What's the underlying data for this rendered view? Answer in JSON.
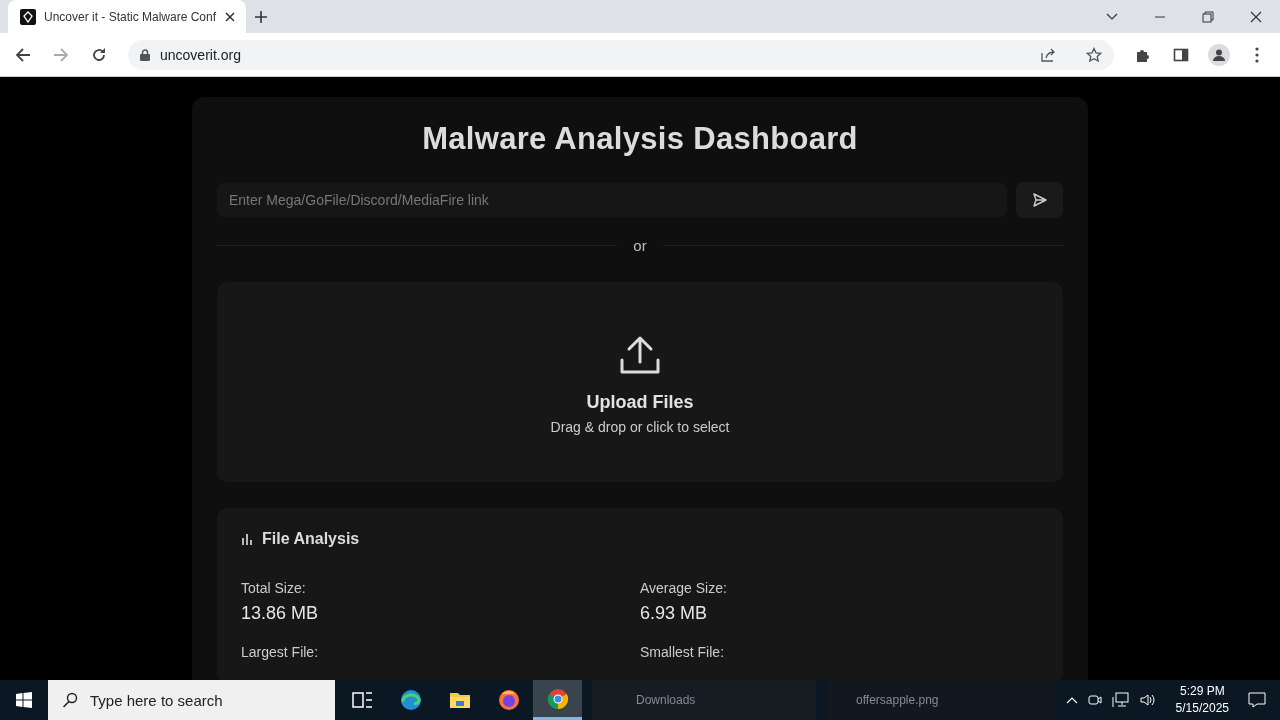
{
  "browser": {
    "tab": {
      "title": "Uncover it - Static Malware Conf",
      "selected": true
    },
    "url": "uncoverit.org"
  },
  "page": {
    "title": "Malware Analysis Dashboard",
    "link_field": {
      "placeholder": "Enter Mega/GoFile/Discord/MediaFire link"
    },
    "divider": "or",
    "upload": {
      "title": "Upload Files",
      "hint": "Drag & drop or click to select"
    },
    "analysis": {
      "title": "File Analysis",
      "stats": [
        {
          "label": "Total Size:",
          "value": "13.86 MB"
        },
        {
          "label": "Average Size:",
          "value": "6.93 MB"
        },
        {
          "label": "Largest File:"
        },
        {
          "label": "Smallest File:"
        }
      ]
    }
  },
  "background_window": [
    "Downloads",
    "offersapple.png"
  ],
  "taskbar": {
    "search": {
      "placeholder": "Type here to search"
    },
    "apps": [
      {
        "kind": "taskview",
        "selected": false
      },
      {
        "kind": "edge",
        "selected": false
      },
      {
        "kind": "files",
        "selected": false
      },
      {
        "kind": "firefox",
        "selected": false
      },
      {
        "kind": "chrome",
        "selected": true
      }
    ],
    "time": "5:29 PM",
    "date": "5/15/2025"
  }
}
